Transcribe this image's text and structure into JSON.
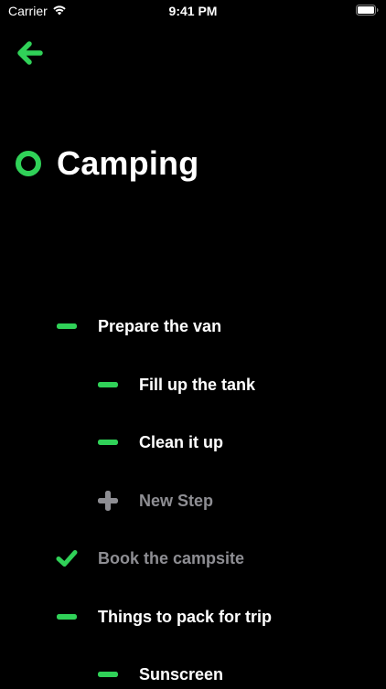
{
  "status_bar": {
    "carrier": "Carrier",
    "time": "9:41 PM"
  },
  "colors": {
    "accent": "#30d158",
    "muted": "#8e8e93",
    "background": "#000000",
    "text": "#ffffff"
  },
  "header": {
    "back_icon": "arrow-left-icon",
    "status_icon": "circle-ring-icon",
    "title": "Camping"
  },
  "steps": [
    {
      "label": "Prepare the van",
      "state": "open",
      "icon": "dash-icon"
    },
    {
      "label": "Fill up the tank",
      "state": "open",
      "icon": "dash-icon"
    },
    {
      "label": "Clean it up",
      "state": "open",
      "icon": "dash-icon"
    },
    {
      "label": "New Step",
      "state": "new",
      "icon": "plus-icon"
    },
    {
      "label": "Book the campsite",
      "state": "done",
      "icon": "checkmark-icon"
    },
    {
      "label": "Things to pack for trip",
      "state": "open",
      "icon": "dash-icon"
    },
    {
      "label": "Sunscreen",
      "state": "open",
      "icon": "dash-icon"
    }
  ]
}
